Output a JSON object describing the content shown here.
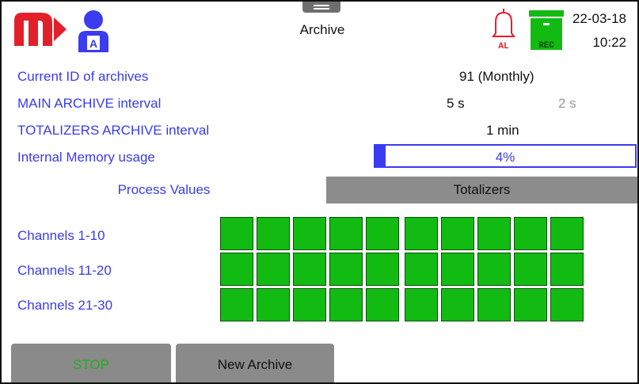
{
  "header": {
    "title": "Archive",
    "date": "22-03-18",
    "time": "10:22",
    "alarm_badge": "AL",
    "rec_badge": "REC",
    "user_badge": "A"
  },
  "info": {
    "current_id_label": "Current ID of archives",
    "current_id_value": "91 (Monthly)",
    "main_interval_label": "MAIN ARCHIVE interval",
    "main_interval_value": "5 s",
    "main_interval_secondary": "2 s",
    "totalizers_interval_label": "TOTALIZERS ARCHIVE interval",
    "totalizers_interval_value": "1 min",
    "memory_label": "Internal Memory usage",
    "memory_value": "4%",
    "memory_fraction": 0.04
  },
  "tabs": [
    {
      "label": "Process Values",
      "active": true
    },
    {
      "label": "Totalizers",
      "active": false
    }
  ],
  "channels": [
    {
      "label": "Channels 1-10",
      "states": [
        "ok",
        "ok",
        "ok",
        "ok",
        "ok",
        "ok",
        "ok",
        "ok",
        "ok",
        "ok"
      ]
    },
    {
      "label": "Channels 11-20",
      "states": [
        "ok",
        "ok",
        "ok",
        "ok",
        "ok",
        "ok",
        "ok",
        "ok",
        "ok",
        "ok"
      ]
    },
    {
      "label": "Channels 21-30",
      "states": [
        "ok",
        "ok",
        "ok",
        "ok",
        "ok",
        "ok",
        "ok",
        "ok",
        "ok",
        "ok"
      ]
    }
  ],
  "buttons": {
    "stop": "STOP",
    "new_archive": "New Archive"
  },
  "colors": {
    "accent": "#3b3bef",
    "logo": "#e3202a",
    "channel_ok": "#12bb12",
    "tab_inactive_bg": "#8c8c8c",
    "button_bg": "#8a8a8a",
    "stop_text": "#1fae1f"
  },
  "icons": {
    "logo": "brand-logo-icon",
    "user": "user-icon",
    "alarm": "bell-alarm-icon",
    "record": "archive-rec-icon"
  }
}
